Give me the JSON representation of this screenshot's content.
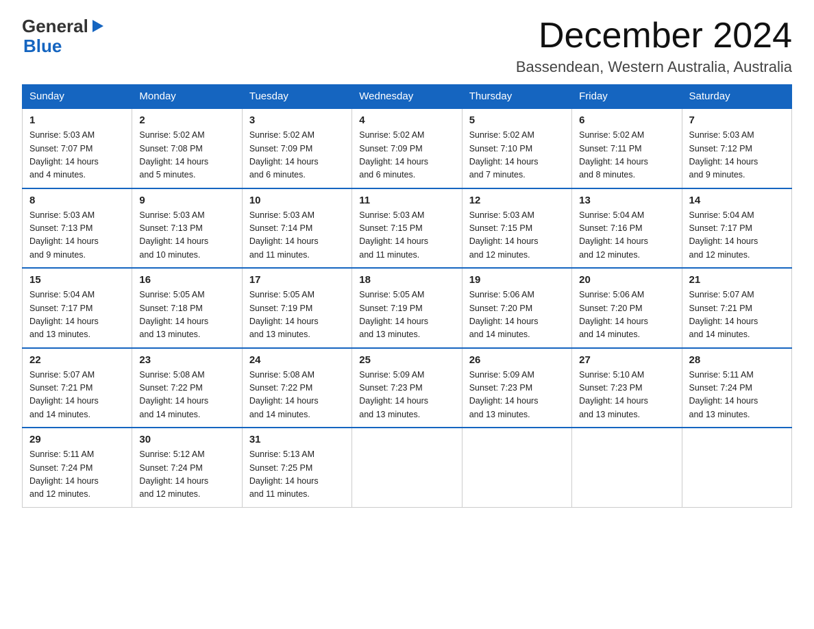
{
  "header": {
    "logo_general": "General",
    "logo_blue": "Blue",
    "month_year": "December 2024",
    "location": "Bassendean, Western Australia, Australia"
  },
  "days_of_week": [
    "Sunday",
    "Monday",
    "Tuesday",
    "Wednesday",
    "Thursday",
    "Friday",
    "Saturday"
  ],
  "weeks": [
    [
      {
        "day": "1",
        "sunrise": "5:03 AM",
        "sunset": "7:07 PM",
        "daylight": "14 hours and 4 minutes."
      },
      {
        "day": "2",
        "sunrise": "5:02 AM",
        "sunset": "7:08 PM",
        "daylight": "14 hours and 5 minutes."
      },
      {
        "day": "3",
        "sunrise": "5:02 AM",
        "sunset": "7:09 PM",
        "daylight": "14 hours and 6 minutes."
      },
      {
        "day": "4",
        "sunrise": "5:02 AM",
        "sunset": "7:09 PM",
        "daylight": "14 hours and 6 minutes."
      },
      {
        "day": "5",
        "sunrise": "5:02 AM",
        "sunset": "7:10 PM",
        "daylight": "14 hours and 7 minutes."
      },
      {
        "day": "6",
        "sunrise": "5:02 AM",
        "sunset": "7:11 PM",
        "daylight": "14 hours and 8 minutes."
      },
      {
        "day": "7",
        "sunrise": "5:03 AM",
        "sunset": "7:12 PM",
        "daylight": "14 hours and 9 minutes."
      }
    ],
    [
      {
        "day": "8",
        "sunrise": "5:03 AM",
        "sunset": "7:13 PM",
        "daylight": "14 hours and 9 minutes."
      },
      {
        "day": "9",
        "sunrise": "5:03 AM",
        "sunset": "7:13 PM",
        "daylight": "14 hours and 10 minutes."
      },
      {
        "day": "10",
        "sunrise": "5:03 AM",
        "sunset": "7:14 PM",
        "daylight": "14 hours and 11 minutes."
      },
      {
        "day": "11",
        "sunrise": "5:03 AM",
        "sunset": "7:15 PM",
        "daylight": "14 hours and 11 minutes."
      },
      {
        "day": "12",
        "sunrise": "5:03 AM",
        "sunset": "7:15 PM",
        "daylight": "14 hours and 12 minutes."
      },
      {
        "day": "13",
        "sunrise": "5:04 AM",
        "sunset": "7:16 PM",
        "daylight": "14 hours and 12 minutes."
      },
      {
        "day": "14",
        "sunrise": "5:04 AM",
        "sunset": "7:17 PM",
        "daylight": "14 hours and 12 minutes."
      }
    ],
    [
      {
        "day": "15",
        "sunrise": "5:04 AM",
        "sunset": "7:17 PM",
        "daylight": "14 hours and 13 minutes."
      },
      {
        "day": "16",
        "sunrise": "5:05 AM",
        "sunset": "7:18 PM",
        "daylight": "14 hours and 13 minutes."
      },
      {
        "day": "17",
        "sunrise": "5:05 AM",
        "sunset": "7:19 PM",
        "daylight": "14 hours and 13 minutes."
      },
      {
        "day": "18",
        "sunrise": "5:05 AM",
        "sunset": "7:19 PM",
        "daylight": "14 hours and 13 minutes."
      },
      {
        "day": "19",
        "sunrise": "5:06 AM",
        "sunset": "7:20 PM",
        "daylight": "14 hours and 14 minutes."
      },
      {
        "day": "20",
        "sunrise": "5:06 AM",
        "sunset": "7:20 PM",
        "daylight": "14 hours and 14 minutes."
      },
      {
        "day": "21",
        "sunrise": "5:07 AM",
        "sunset": "7:21 PM",
        "daylight": "14 hours and 14 minutes."
      }
    ],
    [
      {
        "day": "22",
        "sunrise": "5:07 AM",
        "sunset": "7:21 PM",
        "daylight": "14 hours and 14 minutes."
      },
      {
        "day": "23",
        "sunrise": "5:08 AM",
        "sunset": "7:22 PM",
        "daylight": "14 hours and 14 minutes."
      },
      {
        "day": "24",
        "sunrise": "5:08 AM",
        "sunset": "7:22 PM",
        "daylight": "14 hours and 14 minutes."
      },
      {
        "day": "25",
        "sunrise": "5:09 AM",
        "sunset": "7:23 PM",
        "daylight": "14 hours and 13 minutes."
      },
      {
        "day": "26",
        "sunrise": "5:09 AM",
        "sunset": "7:23 PM",
        "daylight": "14 hours and 13 minutes."
      },
      {
        "day": "27",
        "sunrise": "5:10 AM",
        "sunset": "7:23 PM",
        "daylight": "14 hours and 13 minutes."
      },
      {
        "day": "28",
        "sunrise": "5:11 AM",
        "sunset": "7:24 PM",
        "daylight": "14 hours and 13 minutes."
      }
    ],
    [
      {
        "day": "29",
        "sunrise": "5:11 AM",
        "sunset": "7:24 PM",
        "daylight": "14 hours and 12 minutes."
      },
      {
        "day": "30",
        "sunrise": "5:12 AM",
        "sunset": "7:24 PM",
        "daylight": "14 hours and 12 minutes."
      },
      {
        "day": "31",
        "sunrise": "5:13 AM",
        "sunset": "7:25 PM",
        "daylight": "14 hours and 11 minutes."
      },
      null,
      null,
      null,
      null
    ]
  ],
  "labels": {
    "sunrise": "Sunrise:",
    "sunset": "Sunset:",
    "daylight": "Daylight:"
  }
}
